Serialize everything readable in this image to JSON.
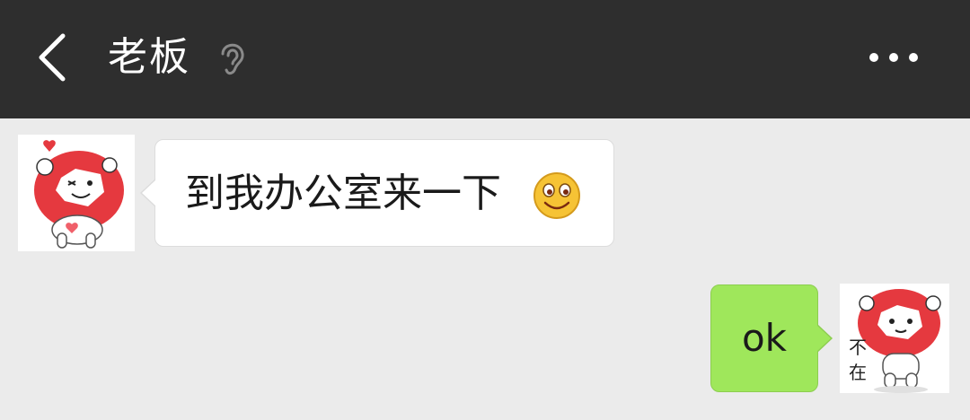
{
  "header": {
    "title": "老板",
    "back_icon": "back-chevron-icon",
    "mute_icon": "ear-icon",
    "more_icon": "more-dots-icon",
    "background_color": "#2e2e2e"
  },
  "chat": {
    "background_color": "#ebebeb",
    "messages": [
      {
        "sender": "other",
        "text": "到我办公室来一下",
        "emoji": "smiley-icon",
        "avatar_icon": "mushroom-heart-sticker-avatar"
      },
      {
        "sender": "self",
        "text": "ok",
        "avatar_icon": "mushroom-not-here-sticker-avatar",
        "avatar_caption": [
          "不",
          "在"
        ],
        "bubble_color": "#9fe75b"
      }
    ]
  }
}
